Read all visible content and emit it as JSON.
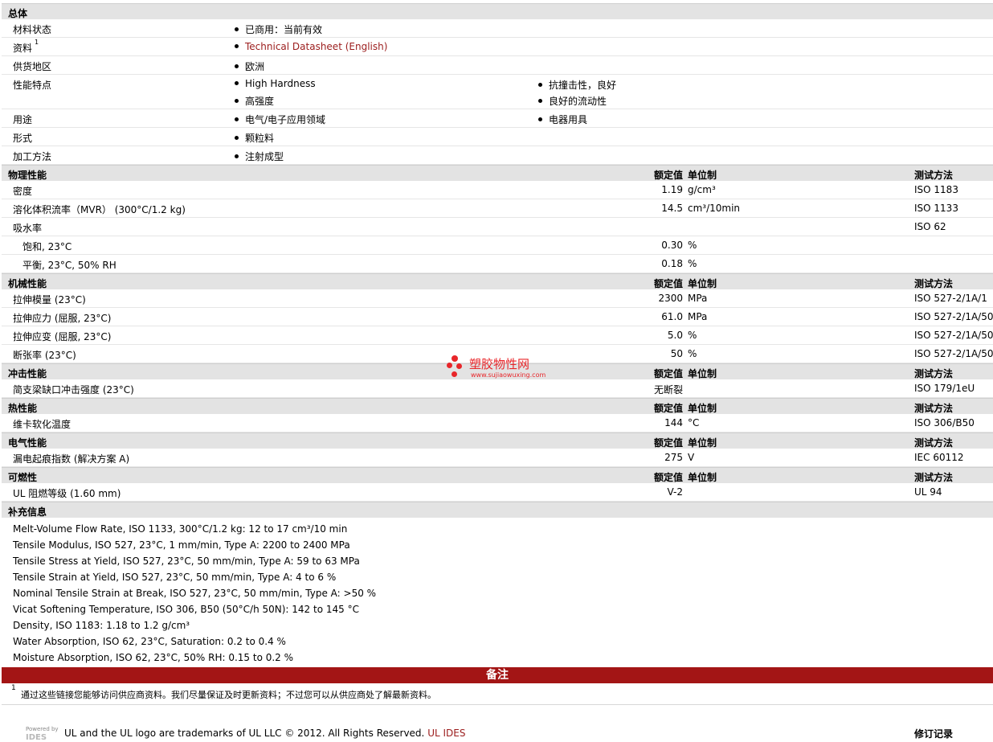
{
  "general": {
    "title": "总体",
    "rows": [
      {
        "label": "材料状态",
        "col1": [
          "已商用：当前有效"
        ],
        "col2": []
      },
      {
        "label": "资料",
        "sup": "1",
        "col1": [
          "Technical Datasheet (English)"
        ],
        "col2": [],
        "link": true
      },
      {
        "label": "供货地区",
        "col1": [
          "欧洲"
        ],
        "col2": []
      },
      {
        "label": "性能特点",
        "col1": [
          "High Hardness",
          "高强度"
        ],
        "col2": [
          "抗撞击性，良好",
          "良好的流动性"
        ]
      },
      {
        "label": "用途",
        "col1": [
          "电气/电子应用领域"
        ],
        "col2": [
          "电器用具"
        ]
      },
      {
        "label": "形式",
        "col1": [
          "颗粒料"
        ],
        "col2": []
      },
      {
        "label": "加工方法",
        "col1": [
          "注射成型"
        ],
        "col2": []
      }
    ]
  },
  "headers": {
    "value": "额定值",
    "unit": "单位制",
    "test": "测试方法"
  },
  "sections": [
    {
      "title": "物理性能",
      "rows": [
        {
          "label": "密度",
          "value": "1.19",
          "unit": "g/cm³",
          "test": "ISO 1183"
        },
        {
          "label": "溶化体积流率（MVR） (300°C/1.2 kg)",
          "value": "14.5",
          "unit": "cm³/10min",
          "test": "ISO 1133"
        },
        {
          "label": "吸水率",
          "value": "",
          "unit": "",
          "test": "ISO 62"
        },
        {
          "label": "饱和, 23°C",
          "value": "0.30",
          "unit": "%",
          "test": "",
          "sub": true
        },
        {
          "label": "平衡, 23°C, 50% RH",
          "value": "0.18",
          "unit": "%",
          "test": "",
          "sub": true
        }
      ]
    },
    {
      "title": "机械性能",
      "rows": [
        {
          "label": "拉伸模量 (23°C)",
          "value": "2300",
          "unit": "MPa",
          "test": "ISO 527-2/1A/1"
        },
        {
          "label": "拉伸应力 (屈服, 23°C)",
          "value": "61.0",
          "unit": "MPa",
          "test": "ISO 527-2/1A/50"
        },
        {
          "label": "拉伸应变 (屈服, 23°C)",
          "value": "5.0",
          "unit": "%",
          "test": "ISO 527-2/1A/50"
        },
        {
          "label": "断张率 (23°C)",
          "value": "50",
          "unit": "%",
          "test": "ISO 527-2/1A/50"
        }
      ]
    },
    {
      "title": "冲击性能",
      "rows": [
        {
          "label": "简支梁缺口冲击强度 (23°C)",
          "value": "无断裂",
          "unit": "",
          "test": "ISO 179/1eU"
        }
      ]
    },
    {
      "title": "热性能",
      "rows": [
        {
          "label": "维卡软化温度",
          "value": "144",
          "unit": "°C",
          "test": "ISO 306/B50"
        }
      ]
    },
    {
      "title": "电气性能",
      "rows": [
        {
          "label": "漏电起痕指数 (解决方案 A)",
          "value": "275",
          "unit": "V",
          "test": "IEC 60112"
        }
      ]
    },
    {
      "title": "可燃性",
      "rows": [
        {
          "label": "UL 阻燃等级 (1.60 mm)",
          "value": "V-2",
          "unit": "",
          "test": "UL 94"
        }
      ]
    }
  ],
  "supplemental": {
    "title": "补充信息",
    "lines": [
      "Melt-Volume Flow Rate, ISO 1133, 300°C/1.2 kg: 12 to 17 cm³/10 min",
      "Tensile Modulus, ISO 527, 23°C, 1 mm/min, Type A: 2200 to 2400 MPa",
      "Tensile Stress at Yield, ISO 527, 23°C, 50 mm/min, Type A: 59 to 63 MPa",
      "Tensile Strain at Yield, ISO 527, 23°C, 50 mm/min, Type A: 4 to 6 %",
      "Nominal Tensile Strain at Break, ISO 527, 23°C, 50 mm/min, Type A: >50 %",
      "Vicat Softening Temperature, ISO 306, B50 (50°C/h 50N): 142 to 145 °C",
      "Density, ISO 1183: 1.18 to 1.2 g/cm³",
      "Water Absorption, ISO 62, 23°C, Saturation: 0.2 to 0.4 %",
      "Moisture Absorption, ISO 62, 23°C, 50% RH: 0.15 to 0.2 %"
    ]
  },
  "notes": {
    "title": "备注",
    "footnote_mark": "1",
    "footnote": "通过这些链接您能够访问供应商资料。我们尽量保证及时更新资料；不过您可以从供应商处了解最新资料。"
  },
  "footer": {
    "powered_by": "Powered by",
    "logo_text": "IDES",
    "trademark": "UL and the UL logo are trademarks of UL LLC © 2012. All Rights Reserved.",
    "link": "UL IDES",
    "revision": "修订记录"
  },
  "watermark": {
    "name": "塑胶物性网",
    "url": "www.sujiaowuxing.com"
  },
  "colors": {
    "link": "#9b1c1c",
    "notes_bar": "#a31515",
    "watermark": "#e8262a"
  }
}
